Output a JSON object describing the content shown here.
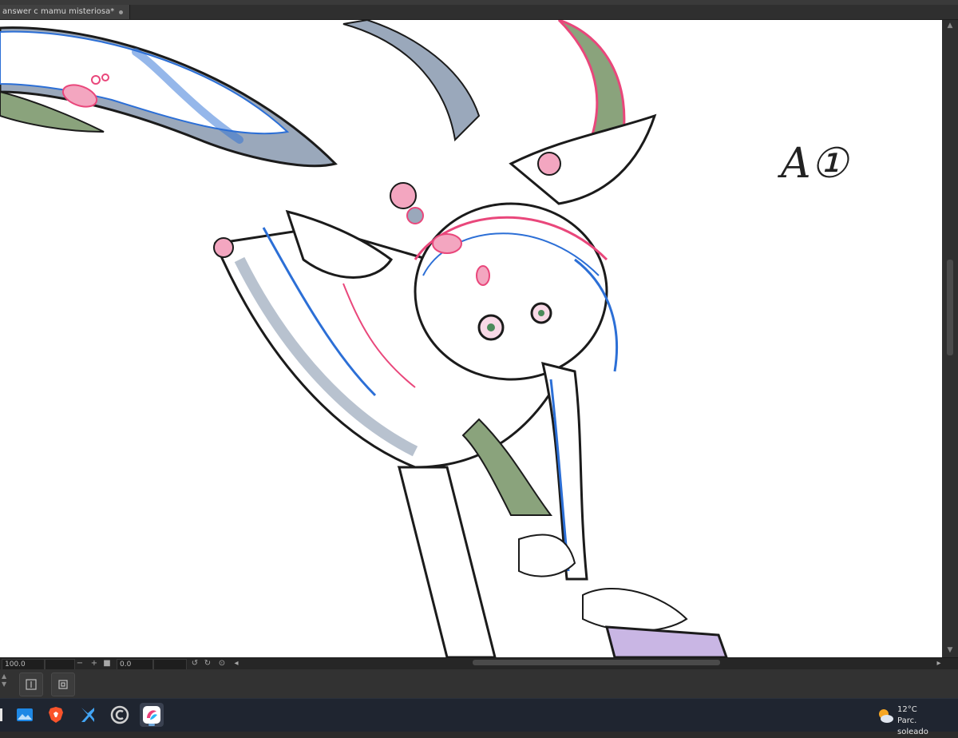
{
  "document": {
    "tab_title": "answer c mamu misteriosa*",
    "canvas_label": "A①"
  },
  "statusbar": {
    "zoom_value": "100.0",
    "zoom_out_symbol": "−",
    "zoom_in_symbol": "+",
    "rotation_value": "0.0"
  },
  "lower_panel": {
    "buttons": [
      {
        "name": "fit-page",
        "icon": "fit-page-icon"
      },
      {
        "name": "reference",
        "icon": "frame-icon"
      }
    ]
  },
  "taskbar": {
    "apps": [
      {
        "name": "photos",
        "icon": "photos-icon"
      },
      {
        "name": "brave-browser",
        "icon": "brave-icon"
      },
      {
        "name": "xmind",
        "icon": "xmind-icon"
      },
      {
        "name": "clip-studio",
        "icon": "clip-studio-icon"
      },
      {
        "name": "clip-studio-paint",
        "icon": "clip-studio-paint-icon"
      }
    ],
    "weather": {
      "temperature": "12°C",
      "condition": "Parc. soleado",
      "icon": "partly-sunny-icon"
    }
  },
  "colors": {
    "canvas_bg": "#ffffff",
    "accent_tab": "#414141",
    "sketch_pink": "#e9477b",
    "sketch_blue": "#2c6fd6",
    "sketch_shadow": "#9aa8bb",
    "sketch_green": "#8aa37c"
  }
}
